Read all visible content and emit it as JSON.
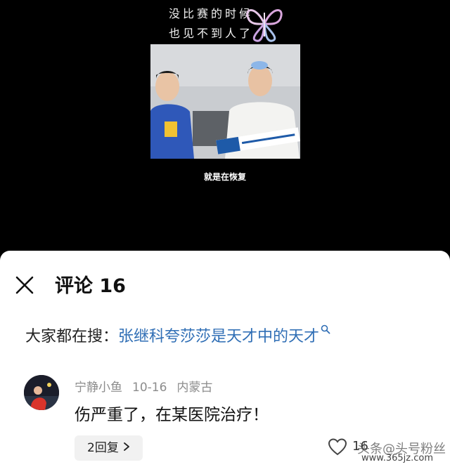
{
  "video": {
    "overlay_line1": "没比赛的时候",
    "overlay_line2": "也见不到人了",
    "caption": "就是在恢复"
  },
  "comments_sheet": {
    "title": "评论 16",
    "search": {
      "prefix": "大家都在搜：",
      "link": "张继科夸莎莎是天才中的天才"
    },
    "comment": {
      "username": "宁静小鱼",
      "date": "10-16",
      "location": "内蒙古",
      "text": "伤严重了，在某医院治疗！",
      "reply_label": "2回复",
      "like_count": "16"
    }
  },
  "watermark": {
    "line1": "头条@头号粉丝",
    "line2": "www.365jz.com"
  },
  "colors": {
    "link": "#2f6eb5",
    "background_top": "#000000",
    "sheet": "#ffffff",
    "reply_bg": "#f1f1f1"
  }
}
